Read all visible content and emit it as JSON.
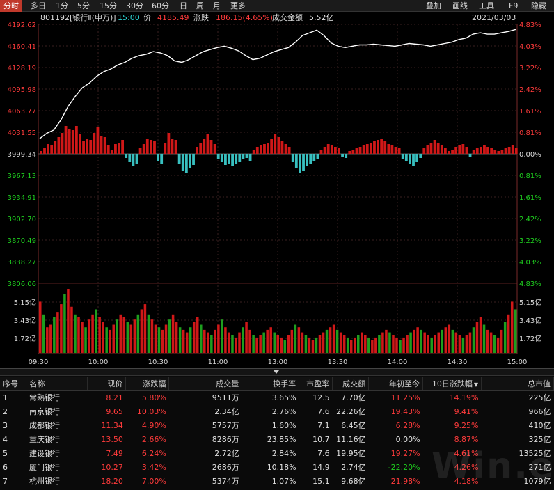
{
  "tabs": [
    "分时",
    "多日",
    "1分",
    "5分",
    "15分",
    "30分",
    "60分",
    "日",
    "周",
    "月",
    "更多"
  ],
  "active_tab": 0,
  "right_tools": [
    "叠加",
    "画线",
    "工具",
    "F9",
    "隐藏"
  ],
  "info": {
    "code_name": "801192[银行Ⅱ(申万)]",
    "time": "15:00",
    "price_label": "价",
    "price": "4185.49",
    "change_label": "涨跌",
    "change": "186.15(4.65%)",
    "amount_label": "成交金额",
    "amount": "5.52亿",
    "date": "2021/03/03"
  },
  "colors": {
    "up": "#ff3b3b",
    "down": "#1fcf1f",
    "line": "#ffffff",
    "bar_up": "#d01818",
    "bar_down": "#38c0c0",
    "vol_up": "#d01818",
    "vol_down": "#1e9e1e"
  },
  "chart_data": {
    "type": "line",
    "price_axis_left": [
      "4192.62",
      "4160.41",
      "4128.19",
      "4095.98",
      "4063.77",
      "4031.55",
      "3999.34",
      "3967.13",
      "3934.91",
      "3902.70",
      "3870.49",
      "3838.27",
      "3806.06"
    ],
    "price_axis_right": [
      "4.83%",
      "4.03%",
      "3.22%",
      "2.42%",
      "1.61%",
      "0.81%",
      "0.00%",
      "0.81%",
      "1.61%",
      "2.42%",
      "3.22%",
      "4.03%",
      "4.83%"
    ],
    "ylim": [
      3806.06,
      4192.62
    ],
    "base": 3999.34,
    "volume_axis": [
      "5.15亿",
      "3.43亿",
      "1.72亿"
    ],
    "time_axis": [
      "09:30",
      "10:00",
      "10:30",
      "11:00",
      "13:00",
      "13:30",
      "14:00",
      "14:30",
      "15:00"
    ],
    "price_series": [
      [
        0,
        4022
      ],
      [
        4,
        4030
      ],
      [
        8,
        4035
      ],
      [
        12,
        4050
      ],
      [
        16,
        4070
      ],
      [
        20,
        4085
      ],
      [
        24,
        4098
      ],
      [
        28,
        4105
      ],
      [
        32,
        4115
      ],
      [
        36,
        4122
      ],
      [
        40,
        4126
      ],
      [
        44,
        4132
      ],
      [
        48,
        4136
      ],
      [
        52,
        4142
      ],
      [
        56,
        4146
      ],
      [
        60,
        4148
      ],
      [
        64,
        4152
      ],
      [
        68,
        4150
      ],
      [
        72,
        4146
      ],
      [
        76,
        4138
      ],
      [
        80,
        4136
      ],
      [
        84,
        4140
      ],
      [
        88,
        4146
      ],
      [
        92,
        4152
      ],
      [
        96,
        4155
      ],
      [
        100,
        4158
      ],
      [
        104,
        4160
      ],
      [
        108,
        4157
      ],
      [
        112,
        4153
      ],
      [
        116,
        4146
      ],
      [
        120,
        4140
      ],
      [
        124,
        4142
      ],
      [
        128,
        4147
      ],
      [
        132,
        4152
      ],
      [
        136,
        4155
      ],
      [
        140,
        4158
      ],
      [
        144,
        4166
      ],
      [
        148,
        4176
      ],
      [
        152,
        4180
      ],
      [
        156,
        4184
      ],
      [
        160,
        4176
      ],
      [
        164,
        4165
      ],
      [
        168,
        4160
      ],
      [
        172,
        4158
      ],
      [
        176,
        4160
      ],
      [
        180,
        4162
      ],
      [
        184,
        4162
      ],
      [
        188,
        4163
      ],
      [
        192,
        4162
      ],
      [
        196,
        4161
      ],
      [
        200,
        4160
      ],
      [
        204,
        4162
      ],
      [
        208,
        4164
      ],
      [
        212,
        4163
      ],
      [
        216,
        4162
      ],
      [
        220,
        4160
      ],
      [
        224,
        4162
      ],
      [
        228,
        4164
      ],
      [
        232,
        4166
      ],
      [
        236,
        4170
      ],
      [
        240,
        4172
      ],
      [
        244,
        4178
      ],
      [
        248,
        4180
      ],
      [
        252,
        4178
      ],
      [
        256,
        4178
      ],
      [
        260,
        4180
      ],
      [
        264,
        4182
      ],
      [
        268,
        4185
      ]
    ],
    "bars": [
      4,
      8,
      14,
      12,
      18,
      24,
      30,
      40,
      36,
      34,
      40,
      28,
      18,
      22,
      20,
      30,
      38,
      26,
      24,
      12,
      6,
      14,
      16,
      20,
      -6,
      -12,
      -18,
      -14,
      8,
      14,
      22,
      20,
      18,
      -10,
      -14,
      16,
      30,
      22,
      20,
      -14,
      -24,
      -28,
      -20,
      -16,
      10,
      16,
      22,
      28,
      20,
      14,
      -8,
      -12,
      -16,
      -14,
      -18,
      -14,
      -12,
      -8,
      -6,
      -10,
      6,
      10,
      12,
      14,
      16,
      22,
      28,
      24,
      18,
      14,
      10,
      -12,
      -20,
      -28,
      -24,
      -18,
      -14,
      -10,
      -8,
      6,
      10,
      14,
      12,
      10,
      8,
      -4,
      -6,
      4,
      6,
      8,
      10,
      12,
      14,
      16,
      18,
      20,
      22,
      18,
      14,
      12,
      10,
      8,
      -8,
      -10,
      -14,
      -18,
      -12,
      -6,
      8,
      12,
      16,
      20,
      16,
      12,
      8,
      4,
      6,
      10,
      12,
      14,
      10,
      -4,
      6,
      8,
      10,
      12,
      10,
      8,
      6,
      4,
      6,
      8,
      10,
      12,
      8
    ],
    "volume_series": [
      40,
      30,
      20,
      22,
      28,
      32,
      38,
      46,
      50,
      36,
      30,
      28,
      24,
      20,
      26,
      30,
      34,
      28,
      24,
      20,
      18,
      22,
      26,
      30,
      28,
      24,
      22,
      26,
      30,
      34,
      38,
      30,
      26,
      22,
      20,
      18,
      22,
      26,
      30,
      24,
      20,
      18,
      16,
      20,
      24,
      28,
      22,
      18,
      16,
      14,
      18,
      22,
      26,
      20,
      16,
      14,
      12,
      16,
      20,
      24,
      18,
      14,
      12,
      14,
      16,
      18,
      20,
      16,
      14,
      12,
      10,
      14,
      18,
      22,
      20,
      16,
      14,
      12,
      10,
      12,
      14,
      16,
      18,
      20,
      22,
      18,
      16,
      14,
      12,
      10,
      12,
      14,
      16,
      14,
      12,
      10,
      12,
      14,
      16,
      18,
      16,
      14,
      12,
      10,
      12,
      14,
      16,
      18,
      20,
      18,
      16,
      14,
      12,
      14,
      16,
      18,
      20,
      22,
      18,
      16,
      14,
      12,
      14,
      16,
      20,
      24,
      28,
      22,
      18,
      16,
      14,
      12,
      18,
      24,
      30,
      40,
      34
    ]
  },
  "table": {
    "headers": [
      "序号",
      "名称",
      "现价",
      "涨跌幅",
      "成交量",
      "换手率",
      "市盈率",
      "成交额",
      "年初至今",
      "10日涨跌幅",
      "总市值"
    ],
    "sort_indicator": "▼",
    "rows": [
      {
        "no": "1",
        "name": "常熟银行",
        "price": "8.21",
        "chg": "5.80%",
        "vol": "9511万",
        "turnover": "3.65%",
        "pe": "12.5",
        "amount": "7.70亿",
        "ytd": "11.25%",
        "d10": "14.19%",
        "mcap": "225亿",
        "ytd_color": "red"
      },
      {
        "no": "2",
        "name": "南京银行",
        "price": "9.65",
        "chg": "10.03%",
        "vol": "2.34亿",
        "turnover": "2.76%",
        "pe": "7.6",
        "amount": "22.26亿",
        "ytd": "19.43%",
        "d10": "9.41%",
        "mcap": "966亿",
        "ytd_color": "red"
      },
      {
        "no": "3",
        "name": "成都银行",
        "price": "11.34",
        "chg": "4.90%",
        "vol": "5757万",
        "turnover": "1.60%",
        "pe": "7.1",
        "amount": "6.45亿",
        "ytd": "6.28%",
        "d10": "9.25%",
        "mcap": "410亿",
        "ytd_color": "red"
      },
      {
        "no": "4",
        "name": "重庆银行",
        "price": "13.50",
        "chg": "2.66%",
        "vol": "8286万",
        "turnover": "23.85%",
        "pe": "10.7",
        "amount": "11.16亿",
        "ytd": "0.00%",
        "d10": "8.87%",
        "mcap": "325亿",
        "ytd_color": "white"
      },
      {
        "no": "5",
        "name": "建设银行",
        "price": "7.49",
        "chg": "6.24%",
        "vol": "2.72亿",
        "turnover": "2.84%",
        "pe": "7.6",
        "amount": "19.95亿",
        "ytd": "19.27%",
        "d10": "4.61%",
        "mcap": "13525亿",
        "ytd_color": "red"
      },
      {
        "no": "6",
        "name": "厦门银行",
        "price": "10.27",
        "chg": "3.42%",
        "vol": "2686万",
        "turnover": "10.18%",
        "pe": "14.9",
        "amount": "2.74亿",
        "ytd": "-22.20%",
        "d10": "4.26%",
        "mcap": "271亿",
        "ytd_color": "green"
      },
      {
        "no": "7",
        "name": "杭州银行",
        "price": "18.20",
        "chg": "7.00%",
        "vol": "5374万",
        "turnover": "1.07%",
        "pe": "15.1",
        "amount": "9.68亿",
        "ytd": "21.98%",
        "d10": "4.18%",
        "mcap": "1079亿",
        "ytd_color": "red"
      }
    ]
  },
  "watermark": "Win.e"
}
